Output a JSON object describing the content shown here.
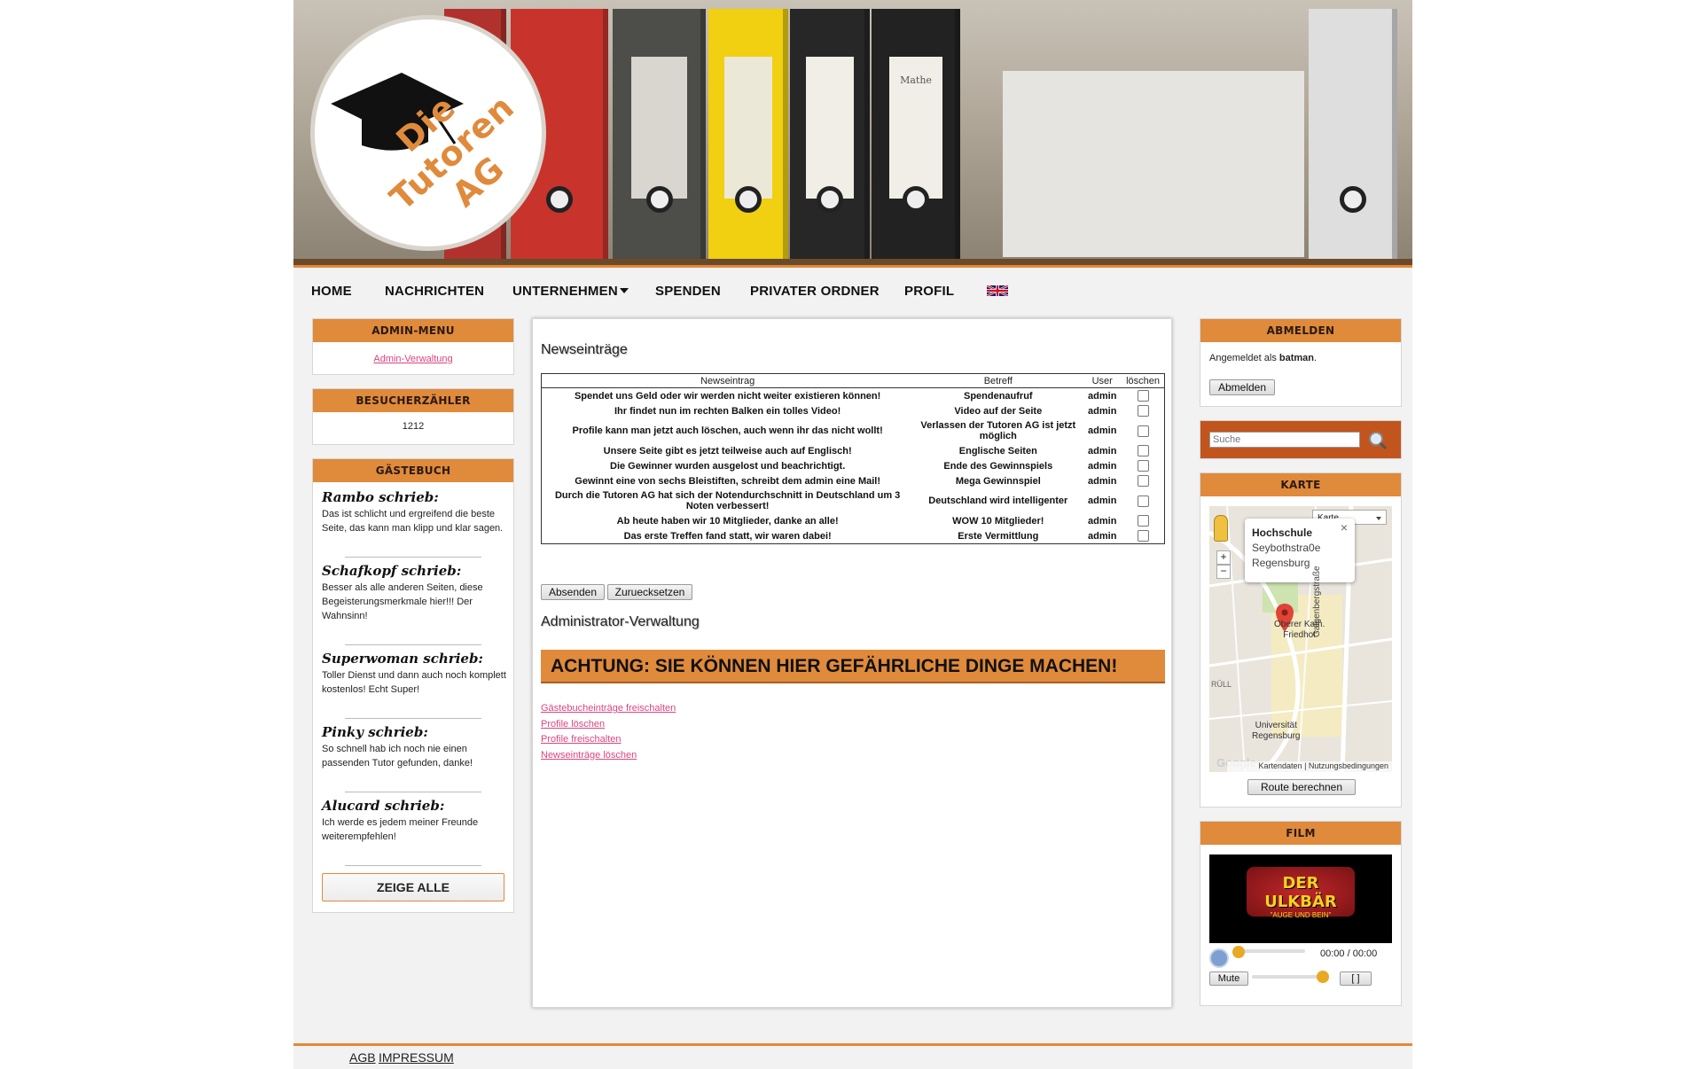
{
  "nav": {
    "items": [
      "Home",
      "Nachrichten",
      "Unternehmen",
      "Spenden",
      "Privater Ordner",
      "Profil"
    ],
    "flag_icon": "uk-flag-icon"
  },
  "header": {
    "logo_text": "Die Tutoren AG"
  },
  "left": {
    "admin_title": "Admin-Menu",
    "admin_link": "Admin-Verwaltung",
    "counter_title": "Besucherzähler",
    "counter_value": "1212",
    "guestbook_title": "Gästebuch",
    "entries": [
      {
        "name": "Rambo schrieb:",
        "text": "Das ist schlicht und ergreifend die beste Seite, das kann man klipp und klar sagen."
      },
      {
        "name": "Schafkopf schrieb:",
        "text": "Besser als alle anderen Seiten, diese Begeisterungsmerkmale hier!!! Der Wahnsinn!"
      },
      {
        "name": "Superwoman schrieb:",
        "text": "Toller Dienst und dann auch noch komplett kostenlos! Echt Super!"
      },
      {
        "name": "Pinky schrieb:",
        "text": "So schnell hab ich noch nie einen passenden Tutor gefunden, danke!"
      },
      {
        "name": "Alucard schrieb:",
        "text": "Ich werde es jedem meiner Freunde weiterempfehlen!"
      }
    ],
    "show_all": "ZEIGE ALLE"
  },
  "main": {
    "news_heading": "Newseinträge",
    "columns": [
      "Newseintrag",
      "Betreff",
      "User",
      "löschen"
    ],
    "rows": [
      {
        "entry": "Spendet uns Geld oder wir werden nicht weiter existieren können!",
        "subject": "Spendenaufruf",
        "user": "admin"
      },
      {
        "entry": "Ihr findet nun im rechten Balken ein tolles Video!",
        "subject": "Video auf der Seite",
        "user": "admin"
      },
      {
        "entry": "Profile kann man jetzt auch löschen, auch wenn ihr das nicht wollt!",
        "subject": "Verlassen der Tutoren AG ist jetzt möglich",
        "user": "admin"
      },
      {
        "entry": "Unsere Seite gibt es jetzt teilweise auch auf Englisch!",
        "subject": "Englische Seiten",
        "user": "admin"
      },
      {
        "entry": "Die Gewinner wurden ausgelost und beachrichtigt.",
        "subject": "Ende des Gewinnspiels",
        "user": "admin"
      },
      {
        "entry": "Gewinnt eine von sechs Bleistiften, schreibt dem admin eine Mail!",
        "subject": "Mega Gewinnspiel",
        "user": "admin"
      },
      {
        "entry": "Durch die Tutoren AG hat sich der Notendurchschnitt in Deutschland um 3 Noten verbessert!",
        "subject": "Deutschland wird intelligenter",
        "user": "admin"
      },
      {
        "entry": "Ab heute haben wir 10 Mitglieder, danke an alle!",
        "subject": "WOW 10 Mitglieder!",
        "user": "admin"
      },
      {
        "entry": "Das erste Treffen fand statt, wir waren dabei!",
        "subject": "Erste Vermittlung",
        "user": "admin"
      }
    ],
    "submit": "Absenden",
    "reset": "Zuruecksetzen",
    "admin_heading": "Administrator-Verwaltung",
    "warning": "ACHTUNG: SIE KÖNNEN HIER GEFÄHRLICHE DINGE MACHEN!",
    "admin_links": [
      "Gästebucheinträge freischalten",
      "Profile löschen",
      "Profile freischalten",
      "Newseinträge löschen"
    ]
  },
  "right": {
    "logout_title": "Abmelden",
    "logged_in_prefix": "Angemeldet als ",
    "username": "batman",
    "logged_in_suffix": ".",
    "logout_button": "Abmelden",
    "search_placeholder": "Suche",
    "map_title": "Karte",
    "map": {
      "type_select": "Karte",
      "popup_title": "Hochschule",
      "popup_line1": "Seybothstra0e",
      "popup_line2": "Regensburg",
      "place1": "Oberer Kath.",
      "place2": "Friedhof",
      "street": "Galgenbergstraße",
      "area": "RÜLL",
      "uni1": "Universität",
      "uni2": "Regensburg",
      "google": "Google",
      "attrib1": "Kartendaten",
      "attrib2": "Nutzungsbedingungen",
      "zoom_in": "+",
      "zoom_out": "−"
    },
    "route_button": "Route berechnen",
    "film_title": "Film",
    "video_logo": "DER ULKBÄR",
    "video_sub": "\"AUGE UND BEIN\"",
    "time": "00:00 / 00:00",
    "mute": "Mute",
    "fullscreen": "[ ]"
  },
  "footer": {
    "agb": "AGB",
    "impressum": "IMPRESSUM"
  },
  "colors": {
    "accent": "#e08a3c",
    "link": "#d9457f"
  }
}
